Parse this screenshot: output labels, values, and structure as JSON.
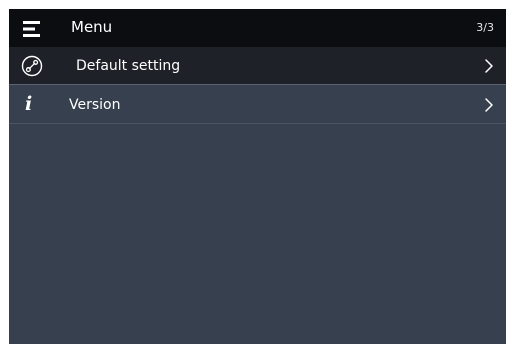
{
  "header": {
    "title": "Menu",
    "page_indicator": "3/3",
    "menu_icon": "hamburger-menu-icon"
  },
  "menu": {
    "items": [
      {
        "label": "Default setting",
        "icon": "wrench-icon",
        "selected": true
      },
      {
        "label": "Version",
        "icon": "info-icon",
        "selected": false
      }
    ]
  },
  "colors": {
    "background": "#36404e",
    "header": "#0c0d11",
    "selected_row": "#1f2128",
    "divider": "#5a6372",
    "text": "#ffffff"
  }
}
